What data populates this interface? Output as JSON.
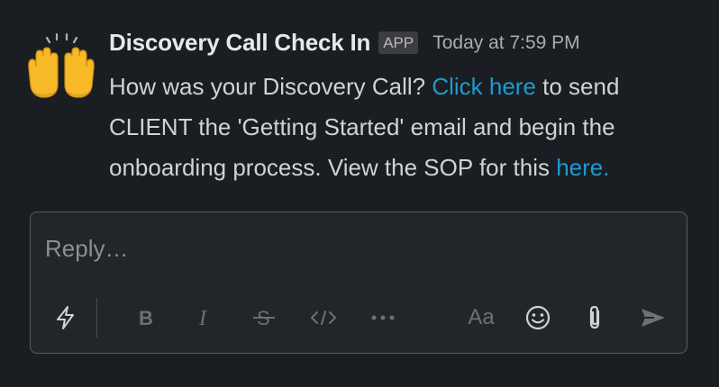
{
  "message": {
    "sender": "Discovery Call Check In",
    "badge": "APP",
    "timestamp": "Today at 7:59 PM",
    "avatar_icon": "raising-hands-emoji",
    "text_1": "How was your Discovery Call? ",
    "link_1": "Click here",
    "text_2": " to send CLIENT the 'Getting Started' email and begin the onboarding process. View the SOP for this ",
    "link_2": "here."
  },
  "composer": {
    "placeholder": "Reply…",
    "toolbar": [
      {
        "name": "shortcuts-icon"
      },
      {
        "name": "bold-icon"
      },
      {
        "name": "italic-icon"
      },
      {
        "name": "strikethrough-icon"
      },
      {
        "name": "code-icon"
      },
      {
        "name": "more-formatting-icon"
      },
      {
        "name": "formatting-toggle",
        "label": "Aa"
      },
      {
        "name": "emoji-icon"
      },
      {
        "name": "attachment-icon"
      },
      {
        "name": "send-icon"
      }
    ],
    "aa_label": "Aa"
  },
  "colors": {
    "background": "#1a1d21",
    "link": "#1d9bd1",
    "text": "#d1d2d3",
    "muted": "#ababad"
  }
}
